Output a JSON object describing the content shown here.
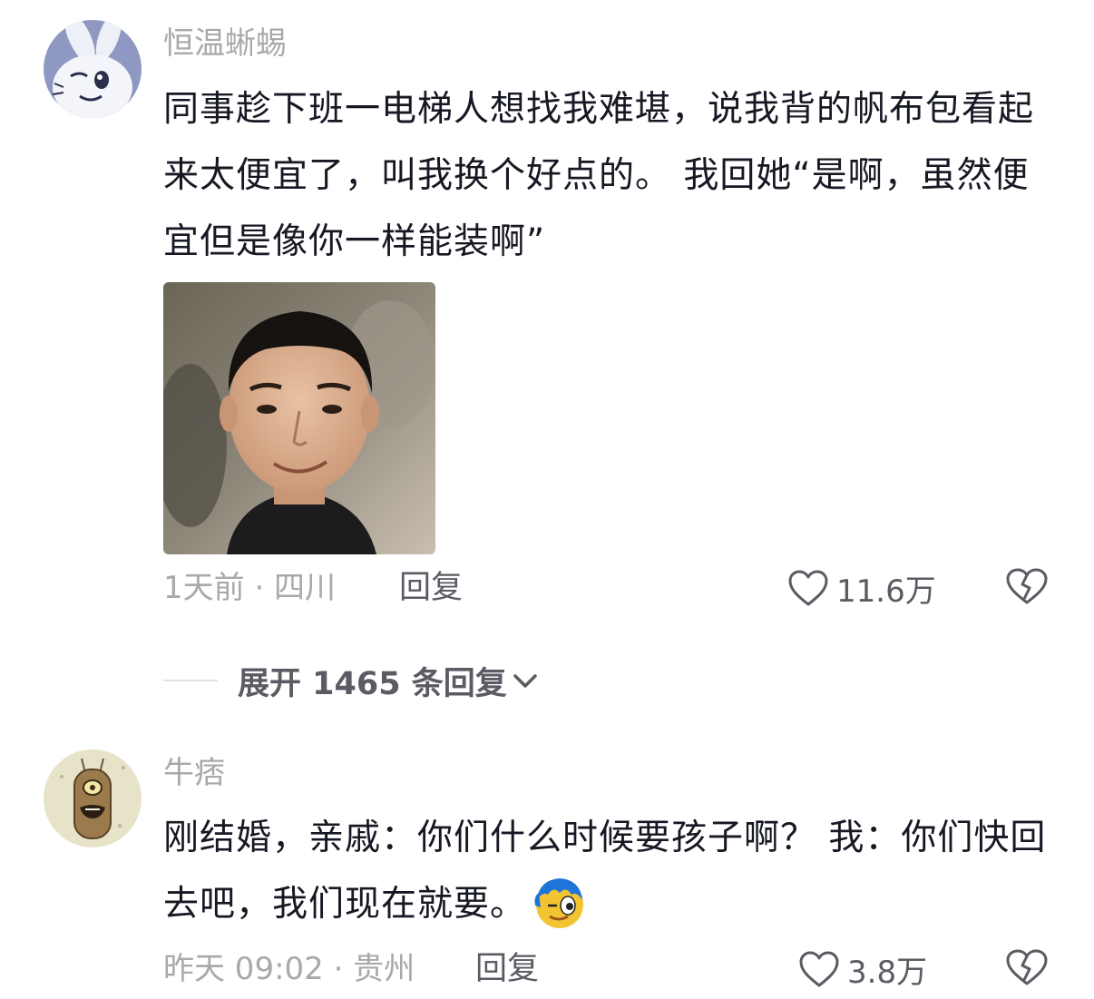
{
  "comments": [
    {
      "username": "恒温蜥蜴",
      "text": "同事趁下班一电梯人想找我难堪，说我背的帆布包看起来太便宜了，叫我换个好点的。 我回她“是啊，虽然便宜但是像你一样能装啊”",
      "meta": "1天前 · 四川",
      "reply_label": "回复",
      "like_count": "11.6万",
      "avatar_icon": "cartoon-rabbit-avatar",
      "image_icon": "smiling-man-photo"
    },
    {
      "username": "牛痞",
      "text": "刚结婚，亲戚：你们什么时候要孩子啊？ 我：你们快回去吧，我们现在就要。",
      "meta": "昨天 09:02 · 贵州",
      "reply_label": "回复",
      "like_count": "3.8万",
      "avatar_icon": "plankton-cartoon-avatar",
      "emoji_icon": "sly-face-emoji"
    }
  ],
  "expand": {
    "label": "展开 1465 条回复",
    "icon": "chevron-down-icon"
  },
  "colors": {
    "primary_text": "#161823",
    "secondary_text": "#a8a8ad",
    "action_text": "#5a5b63"
  }
}
